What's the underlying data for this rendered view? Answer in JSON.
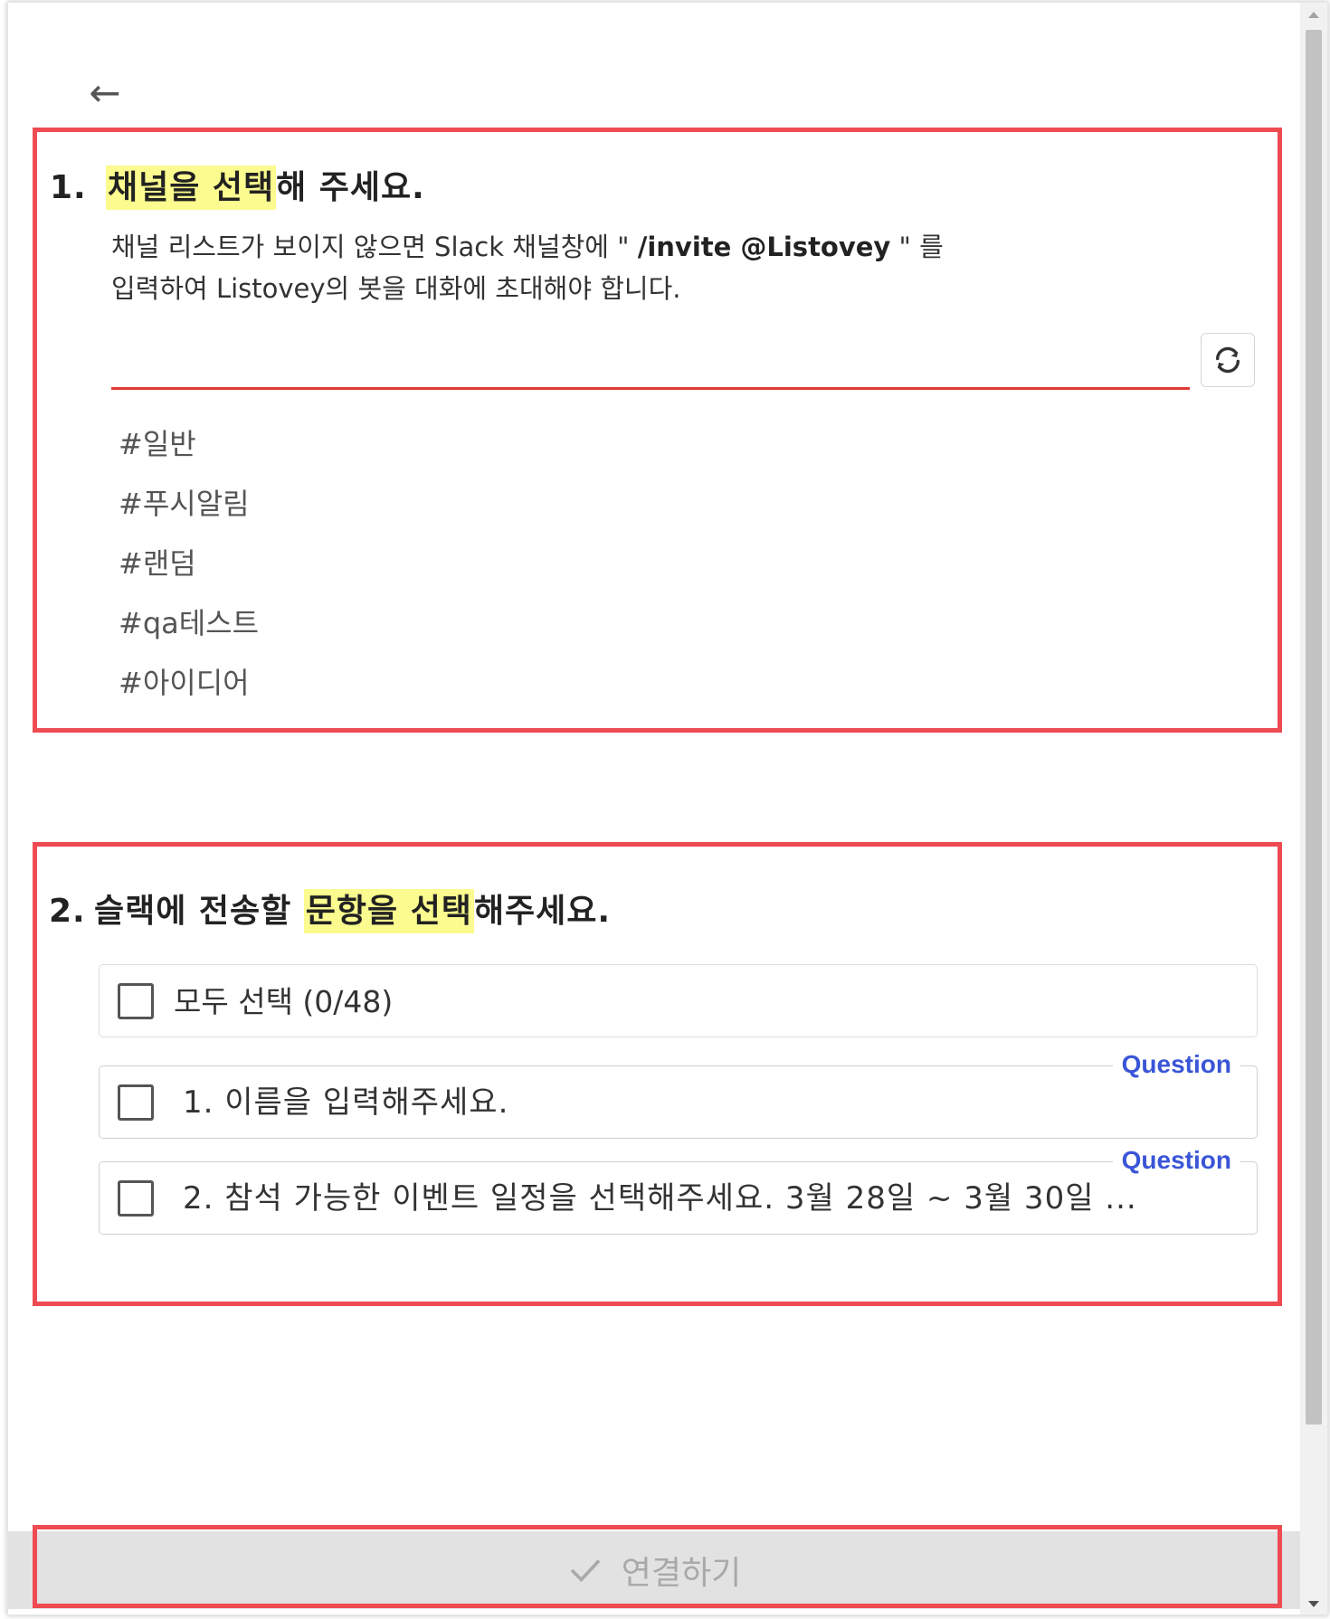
{
  "back": {
    "icon": "arrow-left-icon",
    "glyph": "←"
  },
  "step1": {
    "number": "1.",
    "title_highlight": "채널을 선택",
    "title_rest": "해 주세요.",
    "desc_line1_a": "채널 리스트가 보이지 않으면 Slack 채널창에 \" ",
    "desc_line1_b": "/invite @Listovey",
    "desc_line1_c": " \" 를",
    "desc_line2": "입력하여 Listovey의 봇을 대화에 초대해야 합니다.",
    "refresh_icon": "refresh-icon",
    "channels": [
      "#일반",
      "#푸시알림",
      "#랜덤",
      "#qa테스트",
      "#아이디어"
    ]
  },
  "step2": {
    "number": "2.",
    "title_a": "슬랙에 전송할 ",
    "title_highlight": "문항을 선택",
    "title_rest": "해주세요.",
    "select_all": "모두 선택 (0/48)",
    "items": [
      {
        "tag": "Question",
        "label": "1. 이름을 입력해주세요."
      },
      {
        "tag": "Question",
        "label": "2. 참석 가능한 이벤트 일정을 선택해주세요. 3월 28일 ~ 3월 30일 ..."
      }
    ]
  },
  "connect": {
    "label": "연결하기",
    "icon": "check-icon"
  },
  "colors": {
    "highlight": "#fbfb8f",
    "annotation_red": "#ee4b52",
    "tag_blue": "#3a55d6",
    "underline_red": "#e53935"
  }
}
